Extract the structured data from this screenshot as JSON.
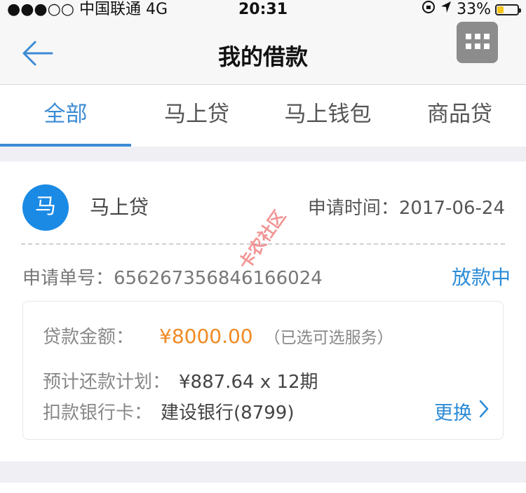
{
  "status_bar": {
    "carrier": "●●●○○ 中国联通   4G",
    "time": "20:31",
    "battery_percent": "33%",
    "battery_level": 0.33
  },
  "header": {
    "title": "我的借款",
    "back_icon": "arrow-left-icon",
    "menu_icon": "grid-menu-icon"
  },
  "tabs": [
    {
      "label": "全部",
      "active": true
    },
    {
      "label": "马上贷",
      "active": false
    },
    {
      "label": "马上钱包",
      "active": false
    },
    {
      "label": "商品贷",
      "active": false
    }
  ],
  "loan": {
    "avatar_text": "马",
    "product": "马上贷",
    "apply_time": "申请时间：2017-06-24",
    "order_label": "申请单号：",
    "order_no": "656267356846166024",
    "status": "放款中",
    "amount_label": "贷款金额：",
    "amount": "¥8000.00",
    "amount_note": "（已选可选服务）",
    "plan_label": "预计还款计划：",
    "plan_value": "¥887.64 x 12期",
    "bank_label": "扣款银行卡：",
    "bank_value": "建设银行(8799)",
    "change_label": "更换"
  },
  "watermark": "卡农社区",
  "colors": {
    "accent": "#3d8bd4",
    "amount": "#f08a24",
    "avatar": "#1a8ae5"
  }
}
